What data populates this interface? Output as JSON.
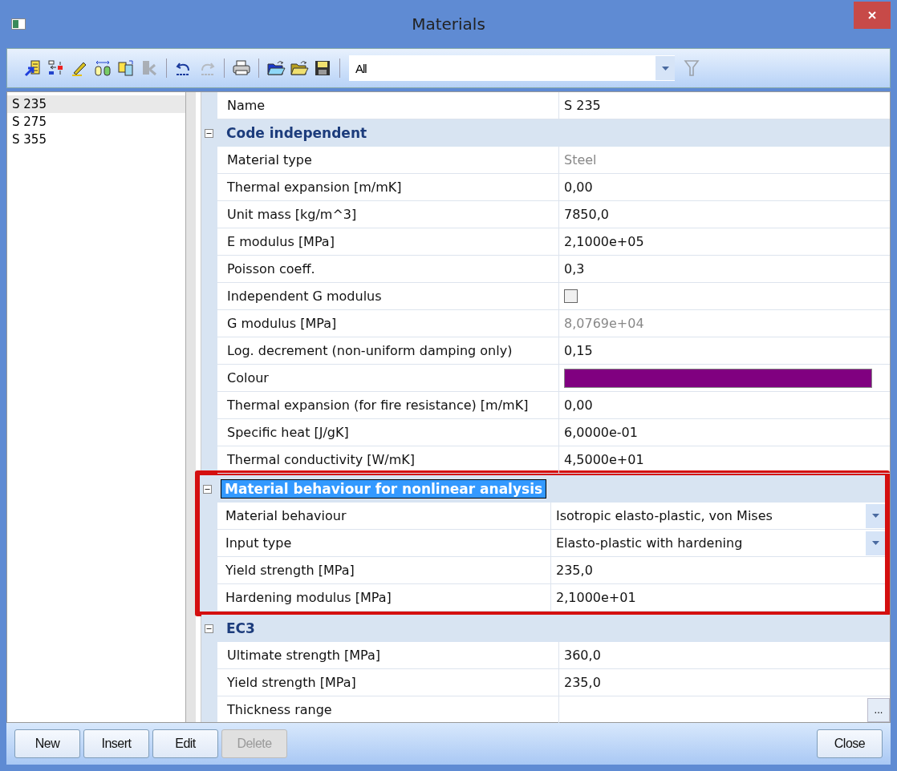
{
  "window": {
    "title": "Materials"
  },
  "toolbar": [
    {
      "kind": "add",
      "disabled": false
    },
    {
      "kind": "move",
      "disabled": false
    },
    {
      "kind": "edit",
      "disabled": false
    },
    {
      "kind": "compare",
      "disabled": false
    },
    {
      "kind": "copy",
      "disabled": false
    },
    {
      "kind": "delete",
      "disabled": true
    },
    {
      "kind": "sep"
    },
    {
      "kind": "undo",
      "disabled": false
    },
    {
      "kind": "redo",
      "disabled": true
    },
    {
      "kind": "sep"
    },
    {
      "kind": "print",
      "disabled": false
    },
    {
      "kind": "sep"
    },
    {
      "kind": "open",
      "disabled": false
    },
    {
      "kind": "open2",
      "disabled": false
    },
    {
      "kind": "save",
      "disabled": false
    },
    {
      "kind": "sep"
    }
  ],
  "filter": {
    "value": "All",
    "disabled": true
  },
  "materials": [
    {
      "label": "S 235",
      "selected": true
    },
    {
      "label": "S 275",
      "selected": false
    },
    {
      "label": "S 355",
      "selected": false
    }
  ],
  "properties": [
    {
      "kind": "row",
      "name": "Name",
      "value": "S 235"
    },
    {
      "kind": "group",
      "title": "Code independent",
      "expanded": true,
      "highlighted": false,
      "selected": false,
      "rows": [
        {
          "kind": "readonly",
          "name": "Material type",
          "value": "Steel"
        },
        {
          "kind": "text",
          "name": "Thermal expansion  [m/mK]",
          "value": "0,00"
        },
        {
          "kind": "text",
          "name": "Unit mass [kg/m^3]",
          "value": "7850,0"
        },
        {
          "kind": "text",
          "name": "E modulus [MPa]",
          "value": "2,1000e+05"
        },
        {
          "kind": "text",
          "name": "Poisson coeff.",
          "value": "0,3"
        },
        {
          "kind": "checkbox",
          "name": "Independent G modulus",
          "checked": false
        },
        {
          "kind": "readonly",
          "name": "G modulus [MPa]",
          "value": "8,0769e+04"
        },
        {
          "kind": "text",
          "name": "Log. decrement (non-uniform damping only)",
          "value": "0,15"
        },
        {
          "kind": "color",
          "name": "Colour",
          "color": "#800080"
        },
        {
          "kind": "text",
          "name": "Thermal expansion (for fire resistance)  [m/mK]",
          "value": "0,00"
        },
        {
          "kind": "text",
          "name": "Specific heat [J/gK]",
          "value": "6,0000e-01"
        },
        {
          "kind": "text",
          "name": "Thermal conductivity [W/mK]",
          "value": "4,5000e+01"
        }
      ]
    },
    {
      "kind": "group",
      "title": "Material behaviour for nonlinear analysis",
      "expanded": true,
      "highlighted": true,
      "selected": true,
      "rows": [
        {
          "kind": "dropdown",
          "name": "Material behaviour",
          "value": "Isotropic elasto-plastic, von Mises"
        },
        {
          "kind": "dropdown",
          "name": "Input type",
          "value": "Elasto-plastic with hardening"
        },
        {
          "kind": "text",
          "name": "Yield strength [MPa]",
          "value": "235,0"
        },
        {
          "kind": "text",
          "name": "Hardening modulus [MPa]",
          "value": "2,1000e+01"
        }
      ]
    },
    {
      "kind": "group",
      "title": "EC3",
      "expanded": true,
      "highlighted": false,
      "selected": false,
      "rows": [
        {
          "kind": "text",
          "name": "Ultimate strength [MPa]",
          "value": "360,0"
        },
        {
          "kind": "text",
          "name": "Yield strength [MPa]",
          "value": "235,0"
        },
        {
          "kind": "ellipsis",
          "name": "Thickness range",
          "value": "",
          "button": "..."
        }
      ]
    }
  ],
  "buttons": [
    {
      "label": "New",
      "disabled": false
    },
    {
      "label": "Insert",
      "disabled": false
    },
    {
      "label": "Edit",
      "disabled": false
    },
    {
      "label": "Delete",
      "disabled": true
    }
  ],
  "close_button": {
    "label": "Close",
    "disabled": false
  }
}
